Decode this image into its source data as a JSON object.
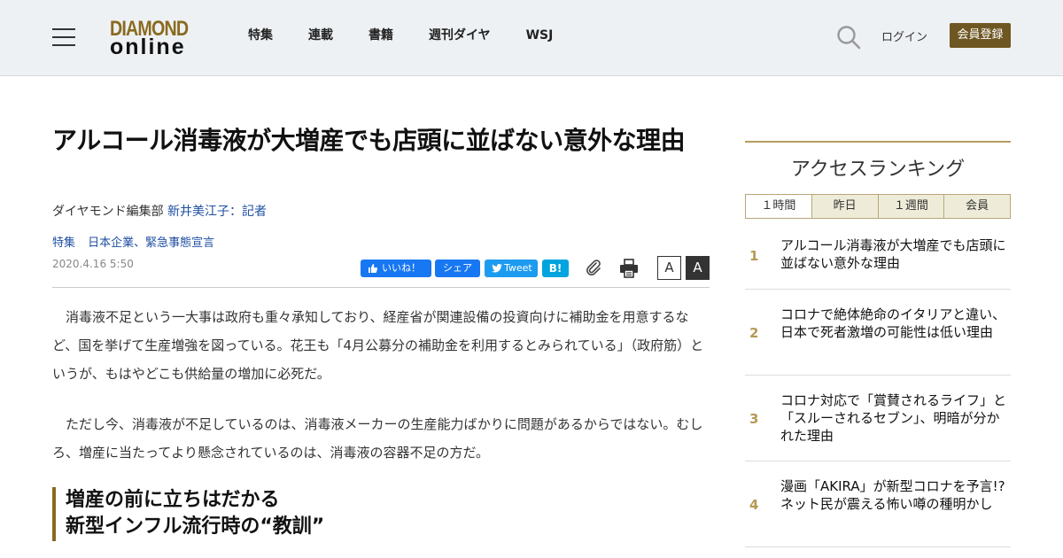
{
  "header": {
    "logo_top": "DIAMOND",
    "logo_bottom": "online",
    "nav": [
      "特集",
      "連載",
      "書籍",
      "週刊ダイヤ",
      "WSJ"
    ],
    "login": "ログイン",
    "register": "会員登録"
  },
  "article": {
    "title": "アルコール消毒液が大増産でも店頭に並ばない意外な理由",
    "byline_dept": "ダイヤモンド編集部",
    "byline_author": "新井美江子：記者",
    "tags": [
      "特集",
      "日本企業、緊急事態宣言"
    ],
    "date": "2020.4.16 5:50",
    "share": {
      "like": "いいね！",
      "share": "シェア",
      "tweet": "Tweet",
      "hatena": "B!"
    },
    "font_small": "A",
    "font_large": "A",
    "paragraphs": [
      "消毒液不足という一大事は政府も重々承知しており、経産省が関連設備の投資向けに補助金を用意するなど、国を挙げて生産増強を図っている。花王も「4月公募分の補助金を利用するとみられている」（政府筋）というが、もはやどこも供給量の増加に必死だ。",
      "ただし今、消毒液が不足しているのは、消毒液メーカーの生産能力ばかりに問題があるからではない。むしろ、増産に当たってより懸念されているのは、消毒液の容器不足の方だ。"
    ],
    "subhead_line1": "増産の前に立ちはだかる",
    "subhead_line2": "新型インフル流行時の“教訓”"
  },
  "sidebar": {
    "ranking_title": "アクセスランキング",
    "tabs": [
      "１時間",
      "昨日",
      "１週間",
      "会員"
    ],
    "items": [
      {
        "rank": "1",
        "text": "アルコール消毒液が大増産でも店頭に並ばない意外な理由"
      },
      {
        "rank": "2",
        "text": "コロナで絶体絶命のイタリアと違い、日本で死者激増の可能性は低い理由"
      },
      {
        "rank": "3",
        "text": "コロナ対応で「賞賛されるライフ」と「スルーされるセブン」、明暗が分かれた理由"
      },
      {
        "rank": "4",
        "text": "漫画「AKIRA」が新型コロナを予言!?ネット民が震える怖い噂の種明かし"
      }
    ]
  }
}
